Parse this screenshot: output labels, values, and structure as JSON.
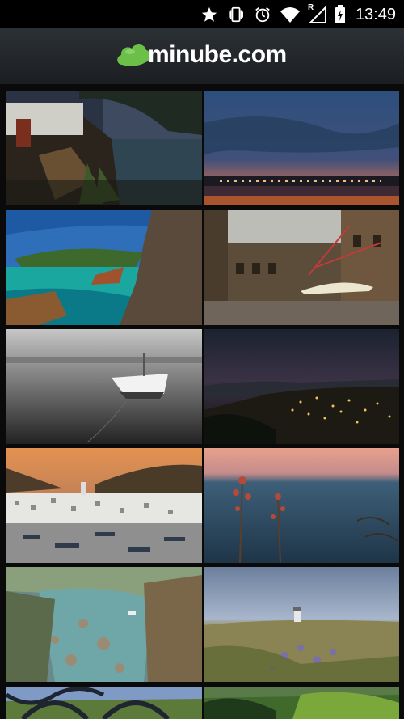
{
  "status_bar": {
    "time": "13:49",
    "icons": [
      "star-icon",
      "vibrate-icon",
      "alarm-icon",
      "wifi-icon",
      "signal-roaming-icon",
      "battery-charging-icon"
    ],
    "roaming_label": "R"
  },
  "app_bar": {
    "brand": "minube.com",
    "brand_color": "#6cc04a"
  },
  "gallery": {
    "photos": [
      {
        "subject": "rocky coast with white house at dusk"
      },
      {
        "subject": "harbor at sunset"
      },
      {
        "subject": "turquoise cove with cliffs"
      },
      {
        "subject": "town square with arcades"
      },
      {
        "subject": "white boat on calm water"
      },
      {
        "subject": "coastal town lights at night"
      },
      {
        "subject": "white village and bay at sunset"
      },
      {
        "subject": "agave flower over the sea"
      },
      {
        "subject": "rocky inlet with pine trees"
      },
      {
        "subject": "lighthouse and wildflowers"
      },
      {
        "subject": "garden through iron gate"
      },
      {
        "subject": "green hillside"
      }
    ]
  }
}
